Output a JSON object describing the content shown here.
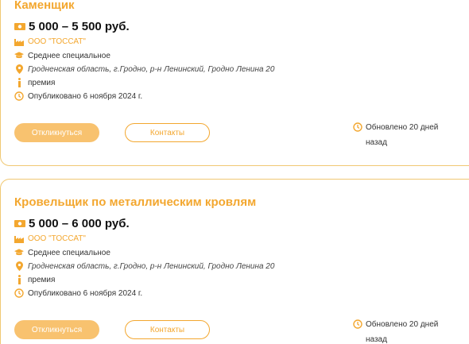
{
  "colors": {
    "accent": "#f3a72f",
    "button_fill": "#f8c26f",
    "border": "#f0c873"
  },
  "vacancies": [
    {
      "title": "Каменщик",
      "salary": "5 000 – 5 500 руб.",
      "company": "ООО \"ТОССАТ\"",
      "education": "Среднее специальное",
      "address": "Гродненская область, г.Гродно, р-н Ленинский, Гродно Ленина 20",
      "bonus": "премия",
      "published": "Опубликовано 6 ноября 2024 г.",
      "apply_label": "Откликнуться",
      "contacts_label": "Контакты",
      "updated_line1": "Обновлено 20 дней",
      "updated_line2": "назад"
    },
    {
      "title": "Кровельщик по металлическим кровлям",
      "salary": "5 000 – 6 000 руб.",
      "company": "ООО \"ТОССАТ\"",
      "education": "Среднее специальное",
      "address": "Гродненская область, г.Гродно, р-н Ленинский, Гродно Ленина 20",
      "bonus": "премия",
      "published": "Опубликовано 6 ноября 2024 г.",
      "apply_label": "Откликнуться",
      "contacts_label": "Контакты",
      "updated_line1": "Обновлено 20 дней",
      "updated_line2": "назад"
    }
  ]
}
